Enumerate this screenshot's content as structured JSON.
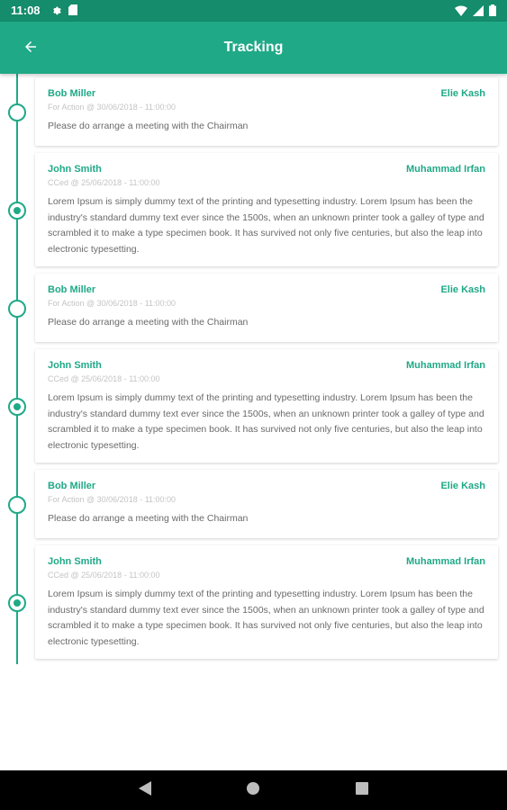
{
  "status_bar": {
    "time": "11:08",
    "left_icons": [
      "gear-icon",
      "sd-card-icon"
    ],
    "right_icons": [
      "wifi-icon",
      "signal-icon",
      "battery-icon"
    ]
  },
  "app_bar": {
    "title": "Tracking",
    "back_icon": "arrow-left-icon",
    "color": "#1fa987",
    "status_color": "#158c6c"
  },
  "entries": [
    {
      "sender": "Bob Miller",
      "recipient": "Elie Kash",
      "meta": "For Action @ 30/06/2018 - 11:00:00",
      "message": "Please do arrange a meeting with the Chairman",
      "node": "open"
    },
    {
      "sender": "John Smith",
      "recipient": "Muhammad Irfan",
      "meta": "CCed @ 25/06/2018 - 11:00:00",
      "message": "Lorem Ipsum is simply dummy text of the printing and typesetting industry. Lorem Ipsum has been the industry's standard dummy text ever since the 1500s, when an unknown printer took a galley of type and scrambled it to make a type specimen book. It has survived not only five centuries, but also the leap into electronic typesetting.",
      "node": "filled"
    },
    {
      "sender": "Bob Miller",
      "recipient": "Elie Kash",
      "meta": "For Action @ 30/06/2018 - 11:00:00",
      "message": "Please do arrange a meeting with the Chairman",
      "node": "open"
    },
    {
      "sender": "John Smith",
      "recipient": "Muhammad Irfan",
      "meta": "CCed @ 25/06/2018 - 11:00:00",
      "message": "Lorem Ipsum is simply dummy text of the printing and typesetting industry. Lorem Ipsum has been the industry's standard dummy text ever since the 1500s, when an unknown printer took a galley of type and scrambled it to make a type specimen book. It has survived not only five centuries, but also the leap into electronic typesetting.",
      "node": "filled"
    },
    {
      "sender": "Bob Miller",
      "recipient": "Elie Kash",
      "meta": "For Action @ 30/06/2018 - 11:00:00",
      "message": "Please do arrange a meeting with the Chairman",
      "node": "open"
    },
    {
      "sender": "John Smith",
      "recipient": "Muhammad Irfan",
      "meta": "CCed @ 25/06/2018 - 11:00:00",
      "message": "Lorem Ipsum is simply dummy text of the printing and typesetting industry. Lorem Ipsum has been the industry's standard dummy text ever since the 1500s, when an unknown printer took a galley of type and scrambled it to make a type specimen book. It has survived not only five centuries, but also the leap into electronic typesetting.",
      "node": "filled"
    }
  ],
  "nav_bar": {
    "buttons": [
      "back-triangle-icon",
      "home-circle-icon",
      "recents-square-icon"
    ]
  }
}
